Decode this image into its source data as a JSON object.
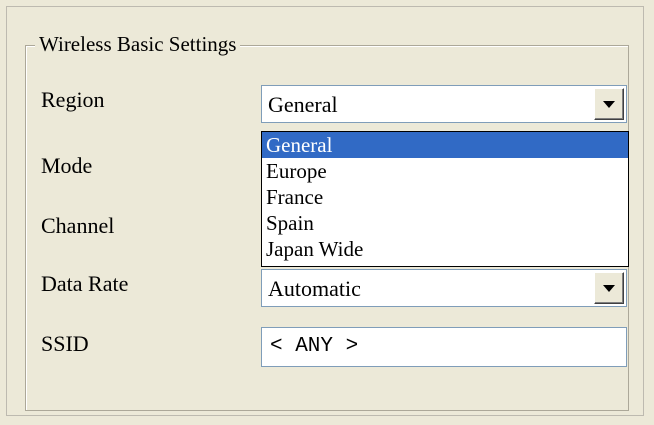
{
  "group": {
    "title": "Wireless Basic Settings"
  },
  "fields": {
    "region_label": "Region",
    "mode_label": "Mode",
    "channel_label": "Channel",
    "data_rate_label": "Data Rate",
    "ssid_label": "SSID"
  },
  "region": {
    "value": "General",
    "options": [
      "General",
      "Europe",
      "France",
      "Spain",
      "Japan Wide"
    ],
    "selected_index": 0
  },
  "data_rate": {
    "value": "Automatic"
  },
  "ssid": {
    "value": "< ANY >"
  },
  "icons": {
    "dropdown_arrow": "chevron-down-icon"
  },
  "colors": {
    "selection": "#316ac5",
    "window_bg": "#ece9d8"
  }
}
